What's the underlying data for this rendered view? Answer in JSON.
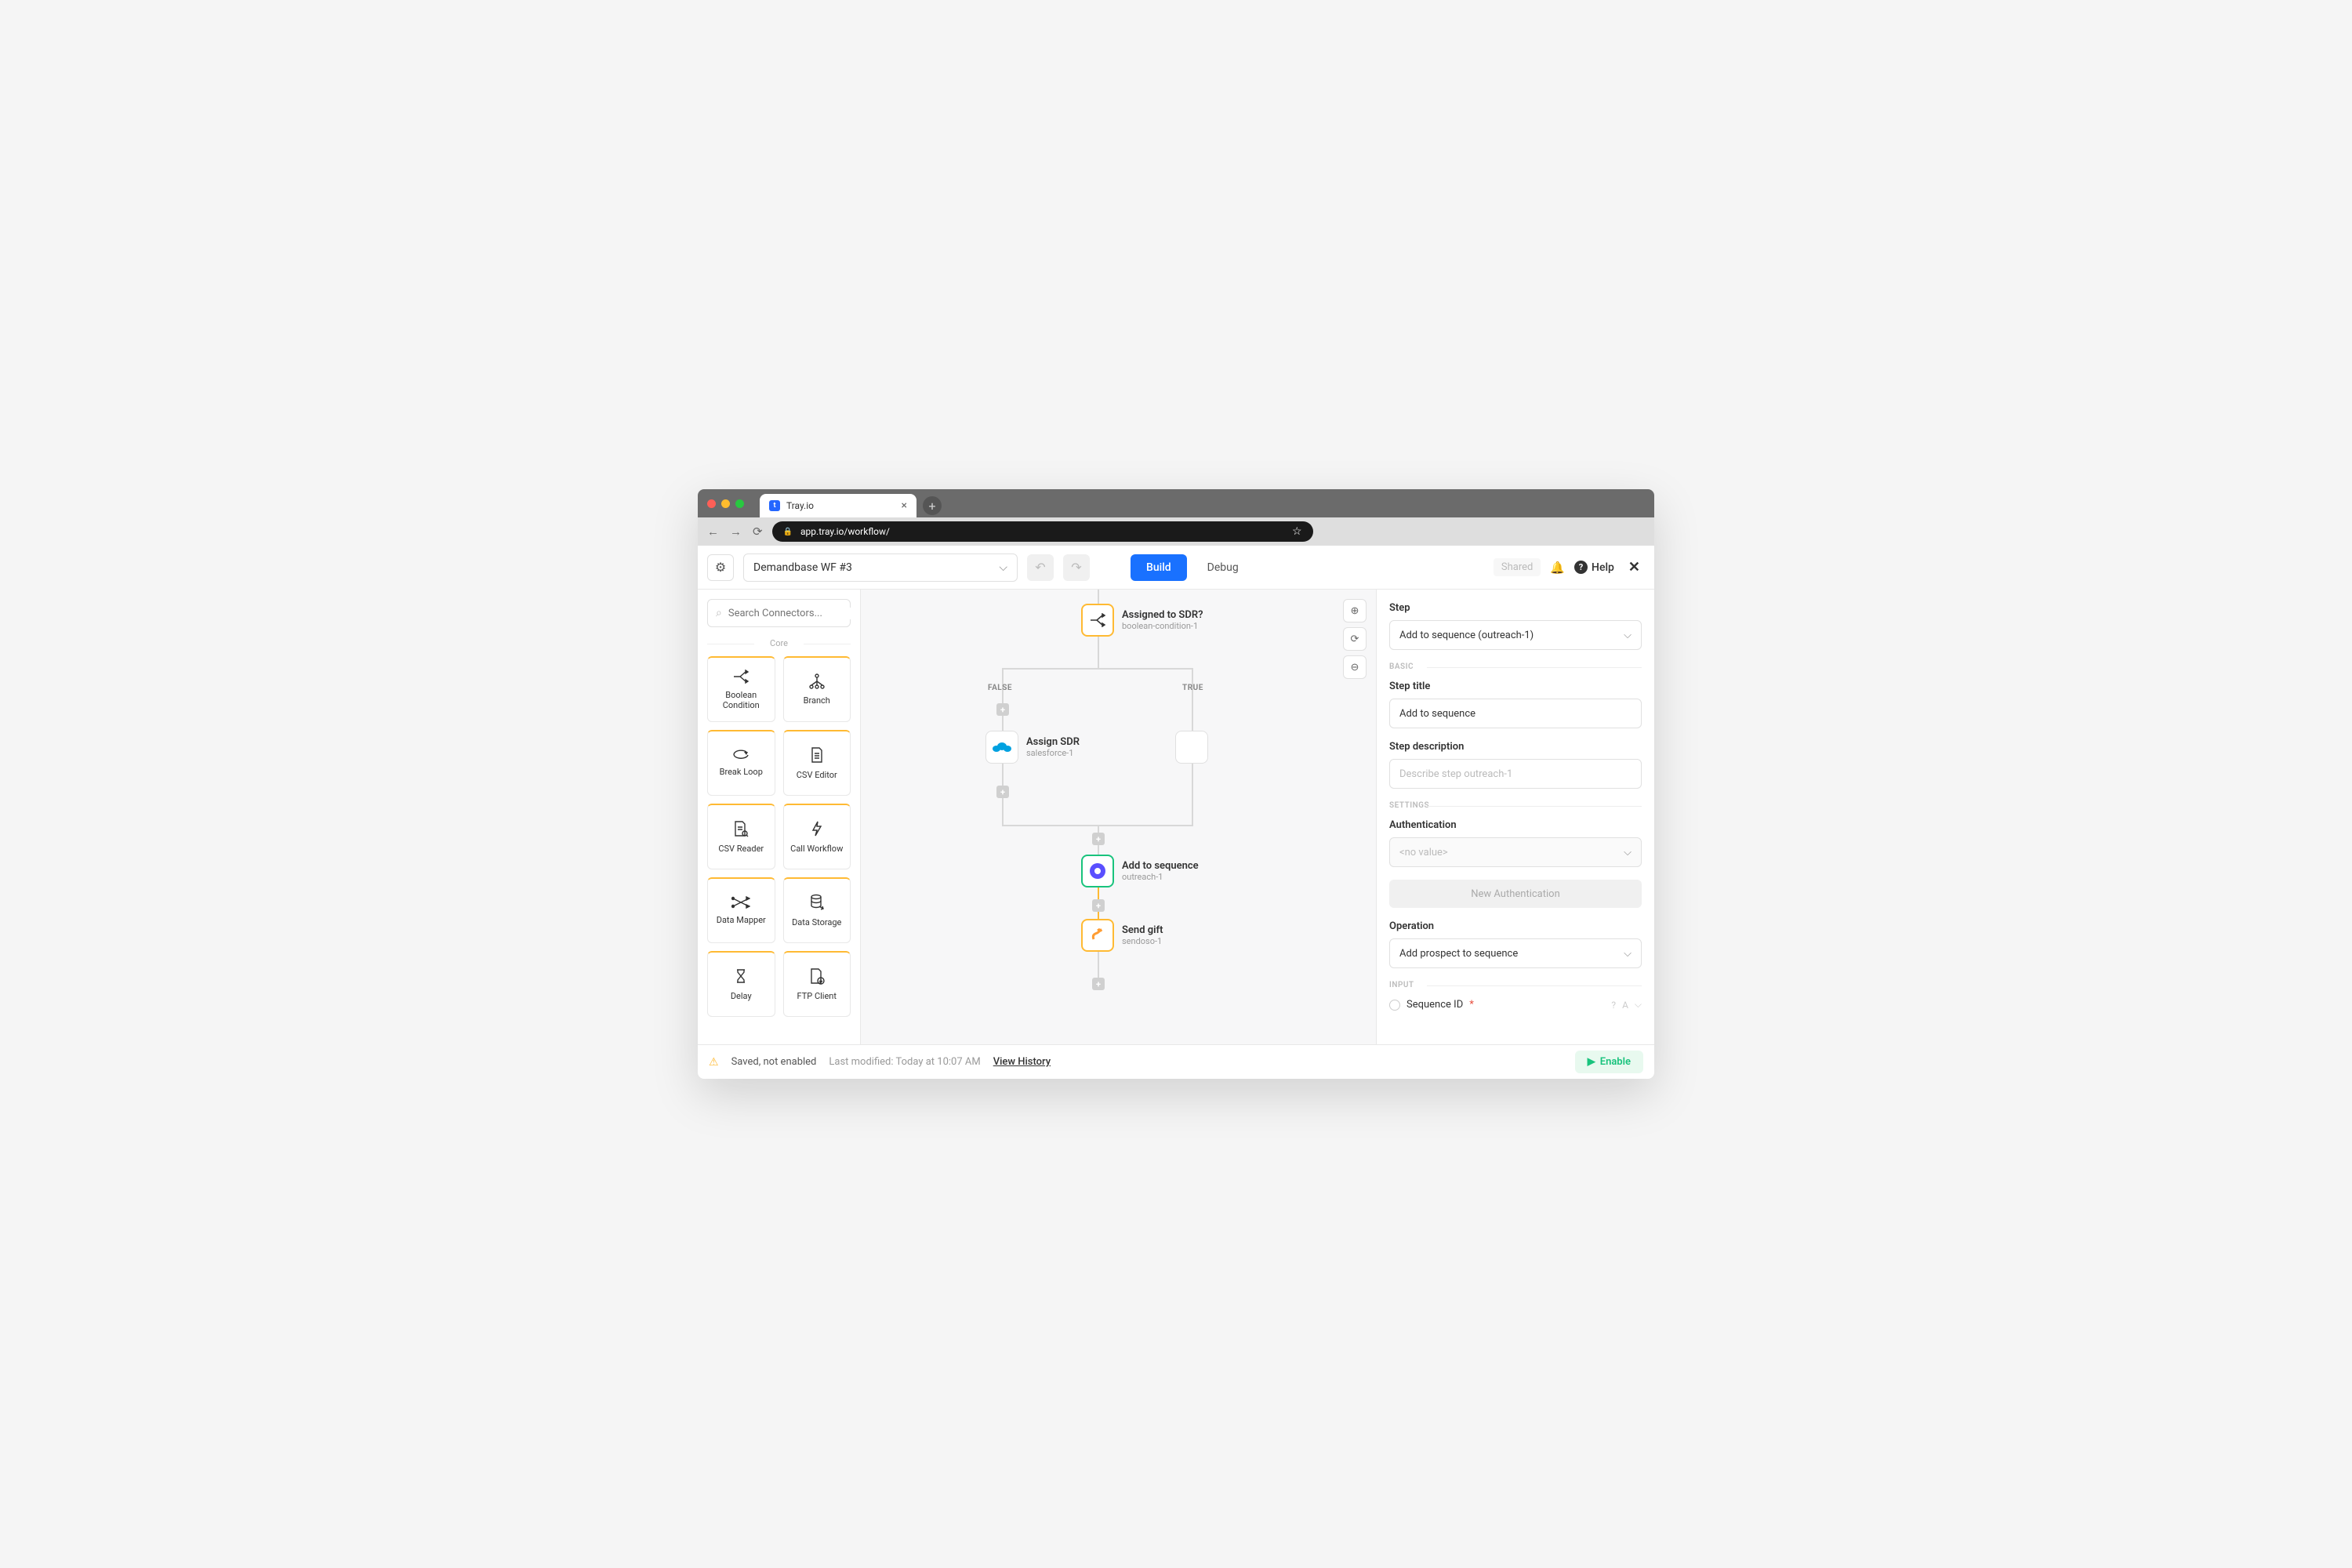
{
  "browser": {
    "tab_title": "Tray.io",
    "url": "app.tray.io/workflow/"
  },
  "toolbar": {
    "workflow_name": "Demandbase WF #3",
    "build": "Build",
    "debug": "Debug",
    "shared": "Shared",
    "help": "Help"
  },
  "sidebar": {
    "search_placeholder": "Search Connectors...",
    "core_label": "Core",
    "connectors": [
      {
        "label": "Boolean Condition"
      },
      {
        "label": "Branch"
      },
      {
        "label": "Break Loop"
      },
      {
        "label": "CSV Editor"
      },
      {
        "label": "CSV Reader"
      },
      {
        "label": "Call Workflow"
      },
      {
        "label": "Data Mapper"
      },
      {
        "label": "Data Storage"
      },
      {
        "label": "Delay"
      },
      {
        "label": "FTP Client"
      }
    ]
  },
  "canvas": {
    "nodes": {
      "bool": {
        "title": "Assigned to SDR?",
        "sub": "boolean-condition-1"
      },
      "false_label": "FALSE",
      "true_label": "TRUE",
      "assign": {
        "title": "Assign SDR",
        "sub": "salesforce-1"
      },
      "addseq": {
        "title": "Add to sequence",
        "sub": "outreach-1"
      },
      "gift": {
        "title": "Send gift",
        "sub": "sendoso-1"
      }
    }
  },
  "props": {
    "step_label": "Step",
    "step_value": "Add to sequence (outreach-1)",
    "basic_label": "BASIC",
    "title_label": "Step title",
    "title_value": "Add to sequence",
    "desc_label": "Step description",
    "desc_placeholder": "Describe step outreach-1",
    "settings_label": "SETTINGS",
    "auth_label": "Authentication",
    "auth_value": "<no value>",
    "newauth": "New Authentication",
    "op_label": "Operation",
    "op_value": "Add prospect to sequence",
    "input_label": "INPUT",
    "seq_id": "Sequence ID"
  },
  "footer": {
    "saved": "Saved, not enabled",
    "modified": "Last modified: Today at 10:07 AM",
    "history": "View History",
    "enable": "Enable"
  }
}
